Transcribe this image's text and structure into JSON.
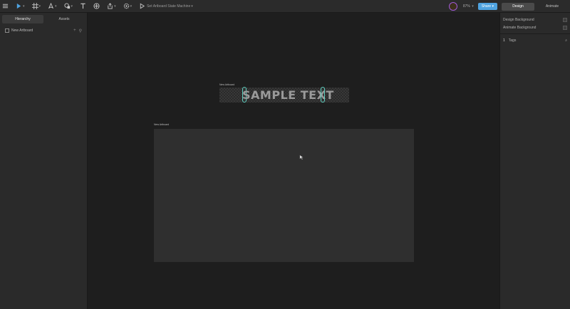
{
  "toolbar": {
    "state_machine_label": "Set Artboard State Machine",
    "zoom": "87%",
    "share_label": "Share",
    "mode_tabs": [
      {
        "label": "Design",
        "active": true
      },
      {
        "label": "Animate",
        "active": false
      }
    ],
    "icons": [
      "menu-icon",
      "play-select-icon",
      "artboard-frame-icon",
      "pen-icon",
      "shape-icon",
      "text-icon",
      "component-icon",
      "export-icon",
      "settings-icon",
      "play-icon"
    ],
    "avatar_color": "#a05ad8",
    "share_color": "#4fa3e0"
  },
  "left_panel": {
    "tabs": [
      {
        "label": "Hierarchy",
        "active": true
      },
      {
        "label": "Assets",
        "active": false
      }
    ],
    "artboard_label": "New Artboard",
    "add_symbol": "+"
  },
  "right_panel": {
    "design_background": "Design Background",
    "animate_background": "Animate Background",
    "tags_count": "1",
    "tags_label": "Tags"
  },
  "canvas": {
    "text_artboard_title": "New Artboard",
    "sample_text": "SAMPLE TEXT",
    "main_artboard_title": "New Artboard",
    "handle_color": "#5fcfc0"
  }
}
